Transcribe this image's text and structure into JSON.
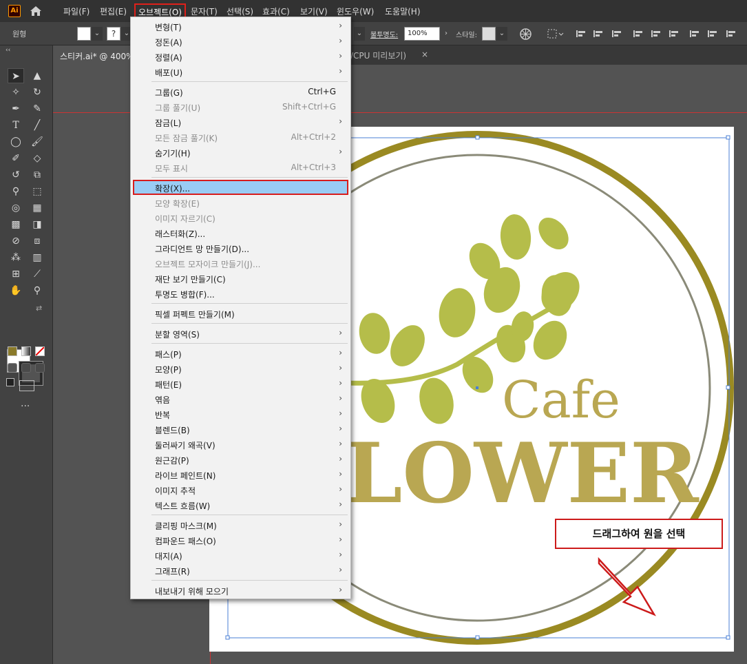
{
  "menubar": {
    "logo": "Ai",
    "items": [
      "파일(F)",
      "편집(E)",
      "오브젝트(O)",
      "문자(T)",
      "선택(S)",
      "효과(C)",
      "보기(V)",
      "윈도우(W)",
      "도움말(H)"
    ]
  },
  "controlbar": {
    "shape_label": "원형",
    "opacity_label": "불투명도:",
    "opacity_value": "100%",
    "style_label": "스타일:"
  },
  "tabs": {
    "active": "스티커.ai* @ 400%",
    "second": "/CPU 미리보기)",
    "close": "×"
  },
  "menu": {
    "groups": [
      [
        {
          "label": "변형(T)",
          "shortcut": "",
          "submenu": true,
          "disabled": false
        },
        {
          "label": "정돈(A)",
          "shortcut": "",
          "submenu": true,
          "disabled": false
        },
        {
          "label": "정렬(A)",
          "shortcut": "",
          "submenu": true,
          "disabled": false
        },
        {
          "label": "배포(U)",
          "shortcut": "",
          "submenu": true,
          "disabled": false
        }
      ],
      [
        {
          "label": "그룹(G)",
          "shortcut": "Ctrl+G",
          "submenu": false,
          "disabled": false
        },
        {
          "label": "그룹 풀기(U)",
          "shortcut": "Shift+Ctrl+G",
          "submenu": false,
          "disabled": true
        },
        {
          "label": "잠금(L)",
          "shortcut": "",
          "submenu": true,
          "disabled": false
        },
        {
          "label": "모든 잠금 풀기(K)",
          "shortcut": "Alt+Ctrl+2",
          "submenu": false,
          "disabled": true
        },
        {
          "label": "숨기기(H)",
          "shortcut": "",
          "submenu": true,
          "disabled": false
        },
        {
          "label": "모두 표시",
          "shortcut": "Alt+Ctrl+3",
          "submenu": false,
          "disabled": true
        }
      ],
      [
        {
          "label": "확장(X)...",
          "shortcut": "",
          "submenu": false,
          "disabled": false,
          "highlighted": true
        },
        {
          "label": "모양 확장(E)",
          "shortcut": "",
          "submenu": false,
          "disabled": true
        },
        {
          "label": "이미지 자르기(C)",
          "shortcut": "",
          "submenu": false,
          "disabled": true
        },
        {
          "label": "래스터화(Z)...",
          "shortcut": "",
          "submenu": false,
          "disabled": false
        },
        {
          "label": "그라디언트 망 만들기(D)...",
          "shortcut": "",
          "submenu": false,
          "disabled": false
        },
        {
          "label": "오브젝트 모자이크 만들기(J)...",
          "shortcut": "",
          "submenu": false,
          "disabled": true
        },
        {
          "label": "재단 보기 만들기(C)",
          "shortcut": "",
          "submenu": false,
          "disabled": false
        },
        {
          "label": "투명도 병합(F)...",
          "shortcut": "",
          "submenu": false,
          "disabled": false
        }
      ],
      [
        {
          "label": "픽셀 퍼펙트 만들기(M)",
          "shortcut": "",
          "submenu": false,
          "disabled": false
        }
      ],
      [
        {
          "label": "분할 영역(S)",
          "shortcut": "",
          "submenu": true,
          "disabled": false
        }
      ],
      [
        {
          "label": "패스(P)",
          "shortcut": "",
          "submenu": true,
          "disabled": false
        },
        {
          "label": "모양(P)",
          "shortcut": "",
          "submenu": true,
          "disabled": false
        },
        {
          "label": "패턴(E)",
          "shortcut": "",
          "submenu": true,
          "disabled": false
        },
        {
          "label": "엮음",
          "shortcut": "",
          "submenu": true,
          "disabled": false
        },
        {
          "label": "반복",
          "shortcut": "",
          "submenu": true,
          "disabled": false
        },
        {
          "label": "블렌드(B)",
          "shortcut": "",
          "submenu": true,
          "disabled": false
        },
        {
          "label": "둘러싸기 왜곡(V)",
          "shortcut": "",
          "submenu": true,
          "disabled": false
        },
        {
          "label": "원근감(P)",
          "shortcut": "",
          "submenu": true,
          "disabled": false
        },
        {
          "label": "라이브 페인트(N)",
          "shortcut": "",
          "submenu": true,
          "disabled": false
        },
        {
          "label": "이미지 추적",
          "shortcut": "",
          "submenu": true,
          "disabled": false
        },
        {
          "label": "텍스트 흐름(W)",
          "shortcut": "",
          "submenu": true,
          "disabled": false
        }
      ],
      [
        {
          "label": "클리핑 마스크(M)",
          "shortcut": "",
          "submenu": true,
          "disabled": false
        },
        {
          "label": "컴파운드 패스(O)",
          "shortcut": "",
          "submenu": true,
          "disabled": false
        },
        {
          "label": "대지(A)",
          "shortcut": "",
          "submenu": true,
          "disabled": false
        },
        {
          "label": "그래프(R)",
          "shortcut": "",
          "submenu": true,
          "disabled": false
        }
      ],
      [
        {
          "label": "내보내기 위해 모으기",
          "shortcut": "",
          "submenu": true,
          "disabled": false
        }
      ]
    ]
  },
  "artwork": {
    "cafe_text": "Cafe",
    "flower_text": "LOWER",
    "ring_color": "#9a8a22",
    "inner_ring_color": "#8a8a78",
    "leaf_color": "#b5bd4a",
    "text_color": "#b9a752",
    "selection_color": "#4a7fd6"
  },
  "annotation": {
    "text": "드래그하여 원을 선택",
    "color": "#cc1a1a"
  }
}
